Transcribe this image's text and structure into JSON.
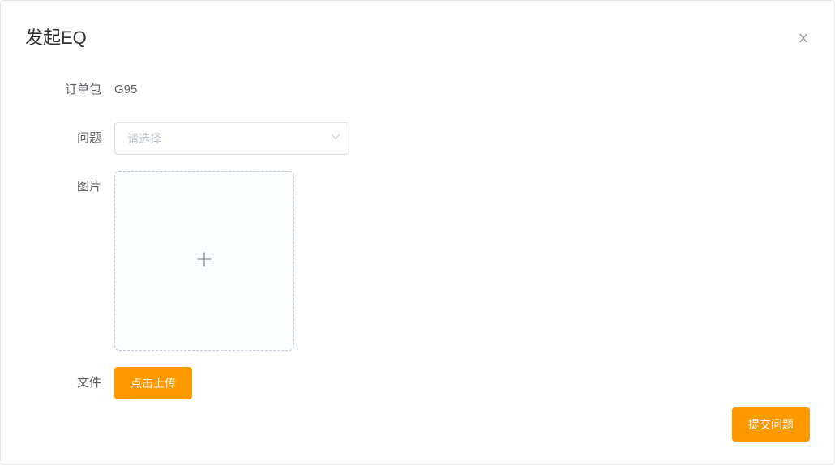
{
  "modal": {
    "title": "发起EQ"
  },
  "form": {
    "order_label": "订单包",
    "order_value": "G95",
    "question_label": "问题",
    "question_placeholder": "请选择",
    "image_label": "图片",
    "file_label": "文件",
    "upload_button": "点击上传",
    "submit_button": "提交问题"
  }
}
